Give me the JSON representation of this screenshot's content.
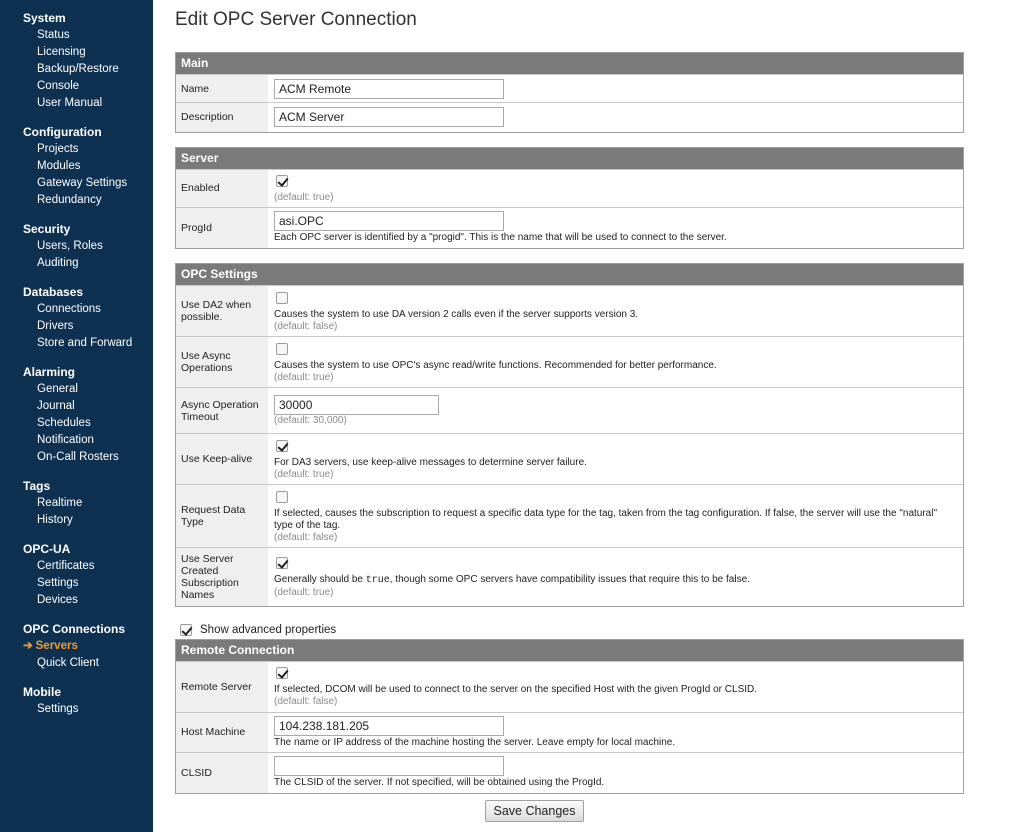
{
  "sidebar": {
    "sections": [
      {
        "heading": "System",
        "items": [
          "Status",
          "Licensing",
          "Backup/Restore",
          "Console",
          "User Manual"
        ]
      },
      {
        "heading": "Configuration",
        "items": [
          "Projects",
          "Modules",
          "Gateway Settings",
          "Redundancy"
        ]
      },
      {
        "heading": "Security",
        "items": [
          "Users, Roles",
          "Auditing"
        ]
      },
      {
        "heading": "Databases",
        "items": [
          "Connections",
          "Drivers",
          "Store and Forward"
        ]
      },
      {
        "heading": "Alarming",
        "items": [
          "General",
          "Journal",
          "Schedules",
          "Notification",
          "On-Call Rosters"
        ]
      },
      {
        "heading": "Tags",
        "items": [
          "Realtime",
          "History"
        ]
      },
      {
        "heading": "OPC-UA",
        "items": [
          "Certificates",
          "Settings",
          "Devices"
        ]
      },
      {
        "heading": "OPC Connections",
        "items": [
          "Servers",
          "Quick Client"
        ]
      },
      {
        "heading": "Mobile",
        "items": [
          "Settings"
        ]
      }
    ],
    "active_arrow": "➔",
    "active_color": "#f39a2b"
  },
  "page": {
    "title": "Edit OPC Server Connection"
  },
  "main_panel": {
    "header": "Main",
    "name_label": "Name",
    "name_value": "ACM Remote",
    "description_label": "Description",
    "description_value": "ACM Server"
  },
  "server_panel": {
    "header": "Server",
    "enabled_label": "Enabled",
    "enabled_checked": true,
    "enabled_default": "(default: true)",
    "progid_label": "ProgId",
    "progid_value": "asi.OPC",
    "progid_desc": "Each OPC server is identified by a \"progid\". This is the name that will be used to connect to the server."
  },
  "opc_panel": {
    "header": "OPC Settings",
    "da2_label": "Use DA2 when possible.",
    "da2_checked": false,
    "da2_desc": "Causes the system to use DA version 2 calls even if the server supports version 3.",
    "da2_default": "(default: false)",
    "async_label": "Use Async Operations",
    "async_checked": false,
    "async_desc": "Causes the system to use OPC's async read/write functions. Recommended for better performance.",
    "async_default": "(default: true)",
    "timeout_label": "Async Operation Timeout",
    "timeout_value": "30000",
    "timeout_default": "(default: 30,000)",
    "keepalive_label": "Use Keep-alive",
    "keepalive_checked": true,
    "keepalive_desc": "For DA3 servers, use keep-alive messages to determine server failure.",
    "keepalive_default": "(default: true)",
    "datatype_label": "Request Data Type",
    "datatype_checked": false,
    "datatype_desc": "If selected, causes the subscription to request a specific data type for the tag, taken from the tag configuration. If false, the server will use the \"natural\" type of the tag.",
    "datatype_default": "(default: false)",
    "subnames_label": "Use Server Created Subscription Names",
    "subnames_checked": true,
    "subnames_desc_pre": "Generally should be ",
    "subnames_desc_true": "true",
    "subnames_desc_mid": ", though some OPC servers have compatibility issues that require this to be ",
    "subnames_desc_false": "false",
    "subnames_desc_end": ".",
    "subnames_default": "(default: true)"
  },
  "advanced": {
    "label": "Show advanced properties",
    "checked": true
  },
  "remote_panel": {
    "header": "Remote Connection",
    "remote_label": "Remote Server",
    "remote_checked": true,
    "remote_desc": "If selected, DCOM will be used to connect to the server on the specified Host with the given ProgId or CLSID.",
    "remote_default": "(default: false)",
    "host_label": "Host Machine",
    "host_value": "104.238.181.205",
    "host_desc": "The name or IP address of the machine hosting the server. Leave empty for local machine.",
    "clsid_label": "CLSID",
    "clsid_value": "",
    "clsid_desc": "The CLSID of the server. If not specified, will be obtained using the ProgId."
  },
  "save_label": "Save Changes"
}
